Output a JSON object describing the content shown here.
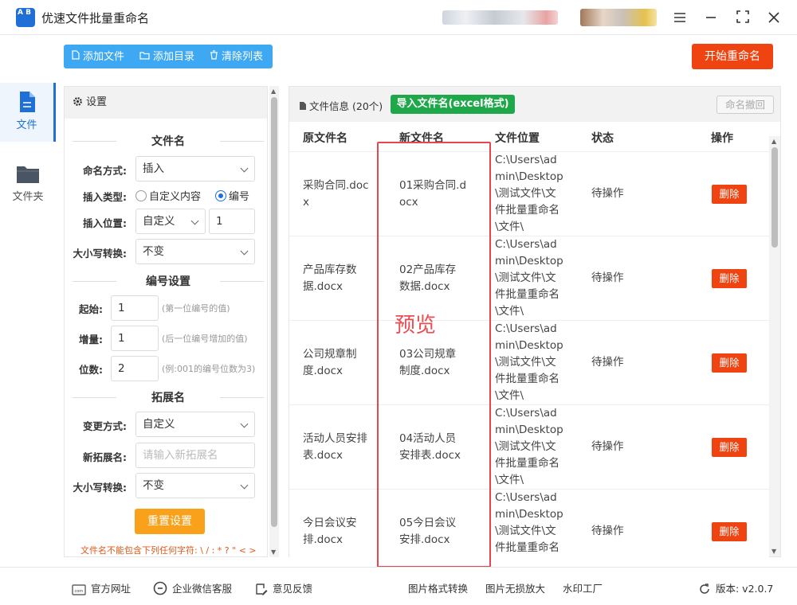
{
  "app": {
    "title": "优速文件批量重命名",
    "logo_text": "A B"
  },
  "toolbar": {
    "add_file": "添加文件",
    "add_dir": "添加目录",
    "clear_list": "清除列表",
    "start_rename": "开始重命名"
  },
  "nav": {
    "file": "文件",
    "folder": "文件夹"
  },
  "settings": {
    "header": "设置",
    "section_filename": "文件名",
    "naming_method_label": "命名方式:",
    "naming_method_value": "插入",
    "insert_type_label": "插入类型:",
    "insert_type_opt1": "自定义内容",
    "insert_type_opt2": "编号",
    "insert_pos_label": "插入位置:",
    "insert_pos_value": "自定义",
    "insert_pos_num": "1",
    "case_label": "大小写转换:",
    "case_value": "不变",
    "section_numbering": "编号设置",
    "start_label": "起始:",
    "start_value": "1",
    "start_hint": "(第一位编号的值)",
    "step_label": "增量:",
    "step_value": "1",
    "step_hint": "(后一位编号增加的值)",
    "digits_label": "位数:",
    "digits_value": "2",
    "digits_hint": "(例:001的编号位数为3)",
    "section_ext": "拓展名",
    "ext_method_label": "变更方式:",
    "ext_method_value": "自定义",
    "new_ext_label": "新拓展名:",
    "new_ext_placeholder": "请输入新拓展名",
    "ext_case_label": "大小写转换:",
    "ext_case_value": "不变",
    "reset": "重置设置",
    "warning": "文件名不能包含下列任何字符: \\ / : * ? \" < >"
  },
  "file_panel": {
    "info_label": "文件信息",
    "count": "(20个)",
    "import_btn": "导入文件名(excel格式)",
    "undo_btn": "命名撤回",
    "columns": [
      "原文件名",
      "新文件名",
      "文件位置",
      "状态",
      "操作"
    ],
    "rows": [
      {
        "orig": [
          "采购合同.doc",
          "x"
        ],
        "new": [
          "01采购合同.d",
          "ocx"
        ],
        "loc": [
          "C:\\Users\\ad",
          "min\\Desktop",
          "\\测试文件\\文",
          "件批量重命名",
          "\\文件\\"
        ],
        "status": "待操作",
        "action": "删除"
      },
      {
        "orig": [
          "产品库存数",
          "据.docx"
        ],
        "new": [
          "02产品库存",
          "数据.docx"
        ],
        "loc": [
          "C:\\Users\\ad",
          "min\\Desktop",
          "\\测试文件\\文",
          "件批量重命名",
          "\\文件\\"
        ],
        "status": "待操作",
        "action": "删除"
      },
      {
        "orig": [
          "公司规章制",
          "度.docx"
        ],
        "new": [
          "03公司规章",
          "制度.docx"
        ],
        "loc": [
          "C:\\Users\\ad",
          "min\\Desktop",
          "\\测试文件\\文",
          "件批量重命名",
          "\\文件\\"
        ],
        "status": "待操作",
        "action": "删除"
      },
      {
        "orig": [
          "活动人员安排",
          "表.docx"
        ],
        "new": [
          "04活动人员",
          "安排表.docx"
        ],
        "loc": [
          "C:\\Users\\ad",
          "min\\Desktop",
          "\\测试文件\\文",
          "件批量重命名",
          "\\文件\\"
        ],
        "status": "待操作",
        "action": "删除"
      },
      {
        "orig": [
          "今日会议安",
          "排.docx"
        ],
        "new": [
          "05今日会议",
          "安排.docx"
        ],
        "loc": [
          "C:\\Users\\ad",
          "min\\Desktop",
          "\\测试文件\\文",
          "件批量重命名",
          ""
        ],
        "status": "待操作",
        "action": "删除"
      }
    ]
  },
  "annotation": {
    "preview": "预览",
    "color": "#e8464e"
  },
  "footer": {
    "website": "官方网址",
    "wechat": "企业微信客服",
    "feedback": "意见反馈",
    "img_convert": "图片格式转换",
    "img_enlarge": "图片无损放大",
    "watermark": "水印工厂",
    "version": "版本: v2.0.7"
  },
  "colors": {
    "accent": "#1f6fd6",
    "toolbar": "#3ea8f3",
    "start": "#ef4411",
    "import": "#1fa84a",
    "reset": "#f9a11b"
  }
}
